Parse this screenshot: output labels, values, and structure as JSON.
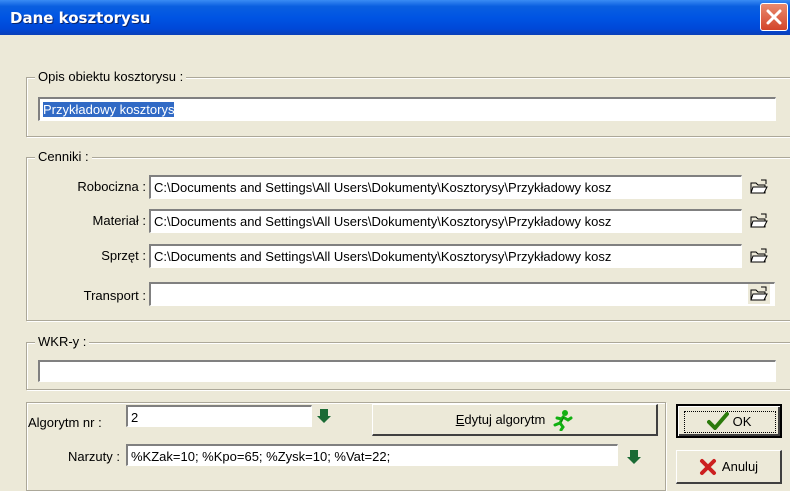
{
  "window": {
    "title": "Dane kosztorysu"
  },
  "opis": {
    "legend": "Opis obiektu kosztorysu :",
    "value": "Przykładowy kosztorys"
  },
  "cenniki": {
    "legend": "Cenniki :",
    "rows": [
      {
        "label": "Robocizna :",
        "value": "C:\\Documents and Settings\\All Users\\Dokumenty\\Kosztorysy\\Przykładowy kosz"
      },
      {
        "label": "Materiał :",
        "value": "C:\\Documents and Settings\\All Users\\Dokumenty\\Kosztorysy\\Przykładowy kosz"
      },
      {
        "label": "Sprzęt :",
        "value": "C:\\Documents and Settings\\All Users\\Dokumenty\\Kosztorysy\\Przykładowy kosz"
      },
      {
        "label": "Transport :",
        "value": ""
      }
    ]
  },
  "wkr": {
    "legend": "WKR-y :",
    "value": ""
  },
  "algorytm": {
    "label": "Algorytm nr :",
    "value": "2",
    "edit_prefix": "E",
    "edit_rest": "dytuj algorytm",
    "narzuty_label": "Narzuty :",
    "narzuty_value": "%KZak=10; %Kpo=65; %Zysk=10; %Vat=22;"
  },
  "buttons": {
    "ok": "OK",
    "anuluj": "Anuluj"
  },
  "colors": {
    "title_bar": "#0054e3",
    "face": "#ece9d8",
    "selection": "#316ac5",
    "ok_check": "#2b7a0b",
    "cancel_x": "#cc1f1f",
    "arrow": "#1a6b35"
  },
  "icons": [
    "close-icon",
    "folder-open-icon",
    "arrow-down-icon",
    "running-man-icon",
    "checkmark-icon",
    "x-icon"
  ]
}
